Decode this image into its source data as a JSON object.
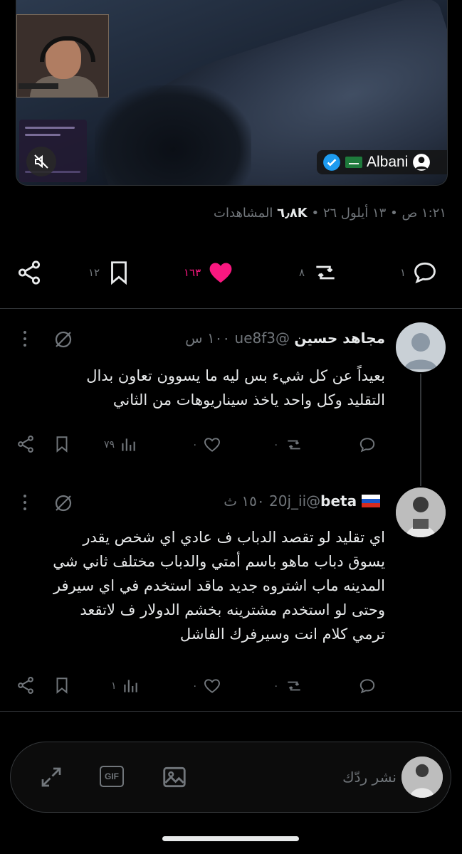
{
  "media": {
    "account_name": "Albani",
    "icons": [
      "verified-icon",
      "saudi-flag-icon",
      "avatar-icon",
      "mute-icon"
    ]
  },
  "meta": {
    "time": "١:٢١ ص",
    "date": "١٣ أيلول ٢٦",
    "views_count": "٦٫٨K",
    "views_label": "المشاهدات",
    "separator": "•"
  },
  "actions": {
    "replies": "١",
    "reposts": "٨",
    "likes": "١٦٣",
    "bookmarks": "١٢",
    "colors": {
      "like": "#f91880",
      "muted": "#71767b"
    }
  },
  "replies": [
    {
      "name": "مجاهد حسين",
      "handle": "@ue8f3",
      "time": "١٠٠ س",
      "lines": [
        "بعيداً عن كل شيء بس ليه ما يسوون تعاون بدال",
        "التقليد وكل واحد ياخذ سيناريوهات من الثاني"
      ],
      "stats": {
        "replies": "",
        "reposts": "٠",
        "likes": "٠",
        "views": "٧٩"
      }
    },
    {
      "name": "beta",
      "handle": "@20j_ii",
      "time": "١٥٠ ث",
      "lines": [
        "اي تقليد لو تقصد الدباب ف عادي اي شخص يقدر",
        "يسوق دباب ماهو باسم أمتي والدباب مختلف ثاني شي",
        "المدينه ماب اشتروه جديد ماقد استخدم في اي سيرفر",
        "وحتى لو استخدم مشترينه بخشم الدولار ف لاتقعد",
        "ترمي كلام انت وسيرفرك الفاشل"
      ],
      "stats": {
        "replies": "",
        "reposts": "٠",
        "likes": "٠",
        "views": "١"
      }
    }
  ],
  "composer": {
    "placeholder": "نشر ردّك",
    "gif_label": "GIF"
  }
}
